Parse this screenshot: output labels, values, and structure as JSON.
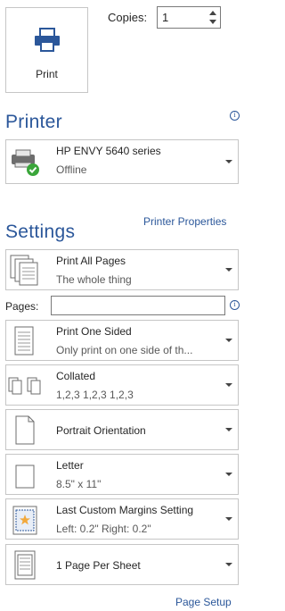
{
  "print_button": {
    "label": "Print",
    "icon": "printer-icon"
  },
  "copies": {
    "label": "Copies:",
    "value": "1"
  },
  "printer": {
    "section_title": "Printer",
    "name": "HP ENVY 5640 series",
    "status": "Offline",
    "properties_link": "Printer Properties"
  },
  "settings": {
    "section_title": "Settings",
    "print_range": {
      "title": "Print All Pages",
      "subtitle": "The whole thing"
    },
    "pages": {
      "label": "Pages:",
      "value": ""
    },
    "sides": {
      "title": "Print One Sided",
      "subtitle": "Only print on one side of th..."
    },
    "collation": {
      "title": "Collated",
      "subtitle": "1,2,3   1,2,3   1,2,3"
    },
    "orientation": {
      "title": "Portrait Orientation"
    },
    "paper_size": {
      "title": "Letter",
      "subtitle": "8.5\" x 11\""
    },
    "margins": {
      "title": "Last Custom Margins Setting",
      "subtitle": "Left: 0.2\"   Right: 0.2\""
    },
    "pages_per_sheet": {
      "title": "1 Page Per Sheet"
    },
    "page_setup_link": "Page Setup"
  },
  "colors": {
    "accent": "#2b579a",
    "border": "#c6c6c6",
    "status_ok": "#3aa63a"
  }
}
